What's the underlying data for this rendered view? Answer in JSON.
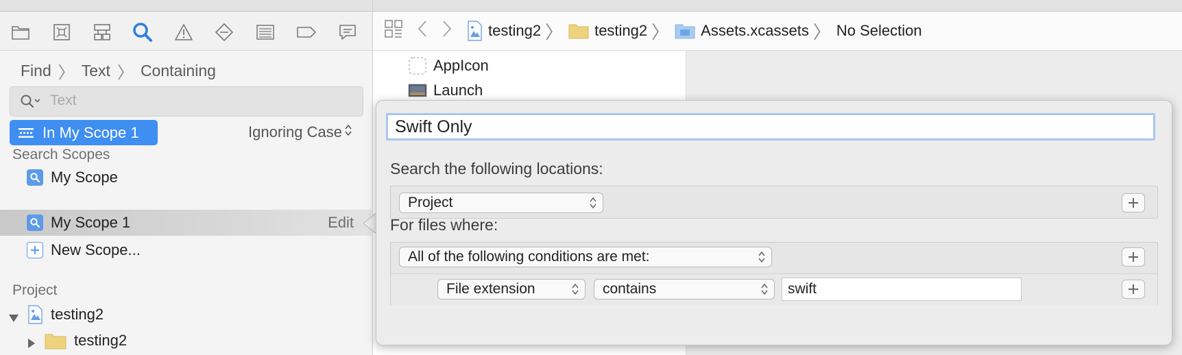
{
  "navigator": {
    "breadcrumb": [
      "Find",
      "Text",
      "Containing"
    ],
    "search": {
      "value": "",
      "placeholder": "Text"
    },
    "scope_button": "In My Scope 1",
    "case_option": "Ignoring Case",
    "search_scopes_header": "Search Scopes",
    "scopes": [
      {
        "label": "My Scope",
        "icon": "magnifier-icon"
      },
      {
        "label": "My Scope 1",
        "icon": "magnifier-icon",
        "selected": true,
        "action": "Edit"
      },
      {
        "label": "New Scope...",
        "icon": "plus-icon"
      }
    ],
    "project_header": "Project",
    "project_items": [
      {
        "label": "testing2",
        "icon": "project-icon",
        "disclosure": "expanded"
      },
      {
        "label": "testing2",
        "icon": "folder-icon",
        "disclosure": "collapsed"
      }
    ]
  },
  "jumpbar": {
    "path": [
      "testing2",
      "testing2",
      "Assets.xcassets",
      "No Selection"
    ]
  },
  "assets": [
    "AppIcon",
    "Launch"
  ],
  "popover": {
    "scope_name": "Swift Only",
    "locations_label": "Search the following locations:",
    "location_popup": "Project",
    "files_label": "For files where:",
    "conditions_popup": "All of the following conditions are met:",
    "criteria": {
      "field": "File extension",
      "operator": "contains",
      "value": "swift"
    }
  },
  "colors": {
    "accent": "#3f8ef2",
    "selection": "#d0d0d0",
    "popover_bg": "#ececec",
    "focus_ring": "#a9c7ee"
  }
}
